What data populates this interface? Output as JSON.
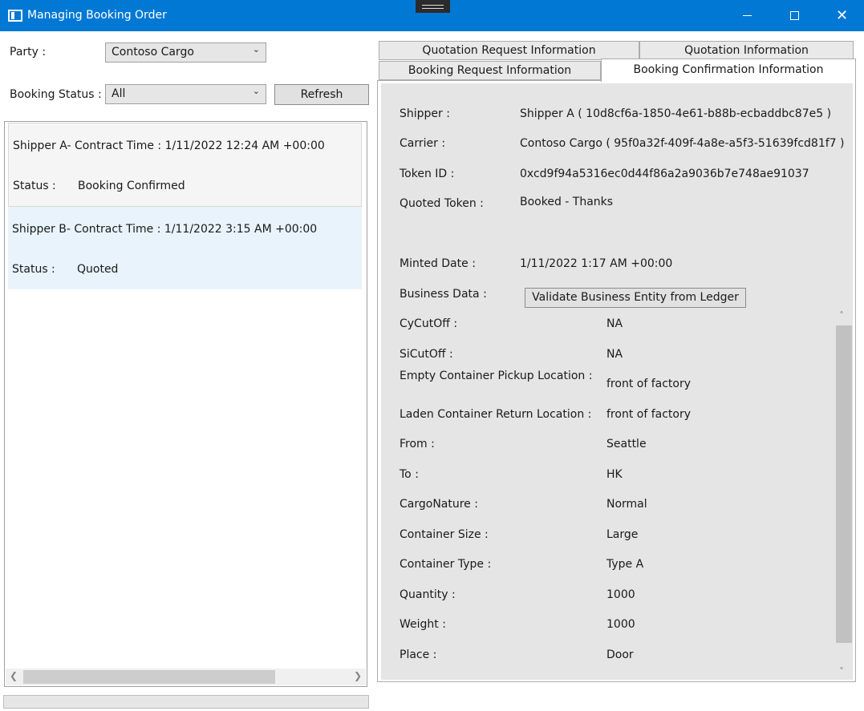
{
  "window": {
    "title": "Managing Booking Order",
    "minimize_glyph": "–",
    "maximize_glyph": "□",
    "close_glyph": "✕"
  },
  "filters": {
    "party_label": "Party :",
    "party_value": "Contoso Cargo",
    "status_label": "Booking Status :",
    "status_value": "All",
    "refresh_label": "Refresh"
  },
  "orders": [
    {
      "header": "Shipper A- Contract Time : 1/11/2022 12:24 AM +00:00",
      "status_label": "Status :",
      "status_value": "Booking Confirmed"
    },
    {
      "header": "Shipper B- Contract Time : 1/11/2022 3:15 AM +00:00",
      "status_label": "Status :",
      "status_value": "Quoted"
    }
  ],
  "tabs": {
    "quotation_request": "Quotation Request Information",
    "quotation": "Quotation Information",
    "booking_request": "Booking Request Information",
    "booking_confirmation": "Booking Confirmation Information",
    "active": "Booking Confirmation Information"
  },
  "confirmation": {
    "shipper_label": "Shipper :",
    "shipper_value": "Shipper A  ( 10d8cf6a-1850-4e61-b88b-ecbaddbc87e5 )",
    "carrier_label": "Carrier :",
    "carrier_value": "Contoso Cargo  ( 95f0a32f-409f-4a8e-a5f3-51639fcd81f7 )",
    "token_label": "Token ID :",
    "token_value": "0xcd9f94a5316ec0d44f86a2a9036b7e748ae91037",
    "quoted_token_label": "Quoted Token :",
    "quoted_token_value": "Booked - Thanks",
    "minted_label": "Minted Date :",
    "minted_value": "1/11/2022 1:17 AM +00:00",
    "business_data_label": "Business Data :",
    "validate_button": "Validate Business Entity from Ledger"
  },
  "business_data": [
    {
      "label": "CyCutOff :",
      "value": "NA"
    },
    {
      "label": "SiCutOff :",
      "value": "NA"
    },
    {
      "label": "Empty Container Pickup Location :",
      "value": "front of factory"
    },
    {
      "label": "Laden Container Return Location :",
      "value": "front of factory"
    },
    {
      "label": "From :",
      "value": "Seattle"
    },
    {
      "label": "To :",
      "value": "HK"
    },
    {
      "label": "CargoNature :",
      "value": "Normal"
    },
    {
      "label": "Container Size :",
      "value": "Large"
    },
    {
      "label": "Container Type :",
      "value": "Type A"
    },
    {
      "label": "Quantity :",
      "value": "1000"
    },
    {
      "label": "Weight :",
      "value": "1000"
    },
    {
      "label": "Place :",
      "value": "Door"
    }
  ]
}
